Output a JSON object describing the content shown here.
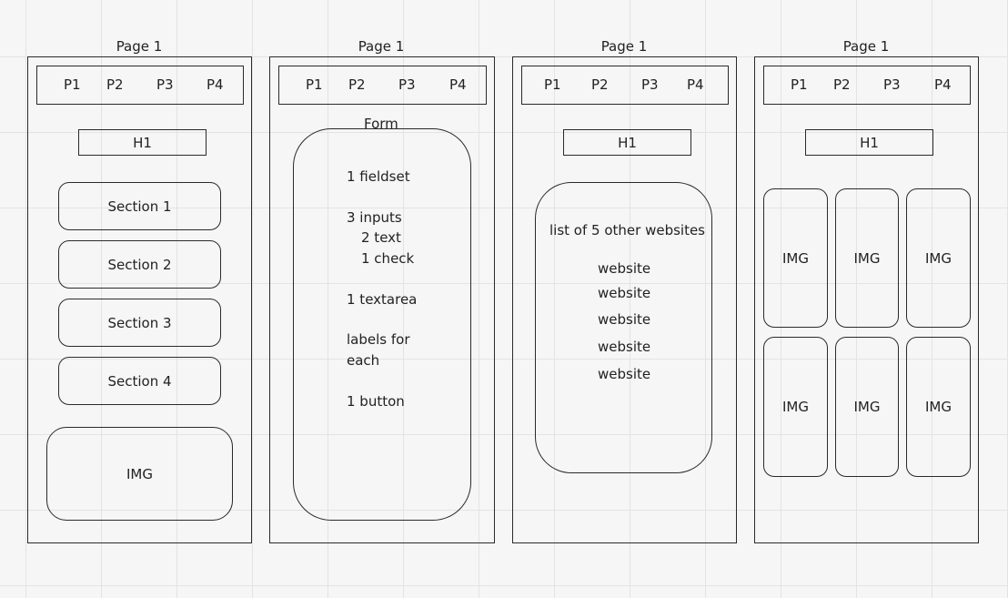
{
  "wireframes": [
    {
      "title": "Page 1",
      "nav": [
        "P1",
        "P2",
        "P3",
        "P4"
      ],
      "heading": "H1",
      "sections": [
        "Section 1",
        "Section 2",
        "Section 3",
        "Section 4"
      ],
      "image": "IMG"
    },
    {
      "title": "Page 1",
      "nav": [
        "P1",
        "P2",
        "P3",
        "P4"
      ],
      "form_label": "Form",
      "form_lines": [
        "1 fieldset",
        "3 inputs",
        "2 text",
        "1 check",
        "1 textarea",
        "labels for",
        "each",
        "1 button"
      ]
    },
    {
      "title": "Page 1",
      "nav": [
        "P1",
        "P2",
        "P3",
        "P4"
      ],
      "heading": "H1",
      "list_title": "list of 5 other websites",
      "list_items": [
        "website",
        "website",
        "website",
        "website",
        "website"
      ]
    },
    {
      "title": "Page 1",
      "nav": [
        "P1",
        "P2",
        "P3",
        "P4"
      ],
      "heading": "H1",
      "images": [
        "IMG",
        "IMG",
        "IMG",
        "IMG",
        "IMG",
        "IMG"
      ]
    }
  ]
}
